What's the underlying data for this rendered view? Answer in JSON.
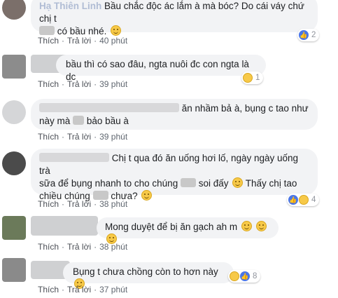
{
  "comments": [
    {
      "name": "Hạ Thiên Linh",
      "line1_rest": "Bầu chắc độc ác lắm à mà bóc? Do cái váy chứ chị t",
      "line2": "có bầu nhé.",
      "actions": {
        "like": "Thích",
        "reply": "Trả lời",
        "time": "40 phút"
      },
      "reaction_count": "2",
      "reactions": [
        "like-icon"
      ]
    },
    {
      "line1": "bầu thì có sao đâu, ngta nuôi đc con ngta là dc",
      "actions": {
        "like": "Thích",
        "reply": "Trả lời",
        "time": "39 phút"
      },
      "reaction_count": "1",
      "reactions": [
        "haha-icon"
      ]
    },
    {
      "line1": "ăn nhầm bả à, bụng c tao như",
      "line2a": "này mà",
      "line2b": "bảo bầu à",
      "actions": {
        "like": "Thích",
        "reply": "Trả lời",
        "time": "39 phút"
      }
    },
    {
      "line1": "Chị t qua đó ăn uống hơi lố, ngày ngày uống trà",
      "line2a": "sữa để bụng nhanh to cho chúng",
      "line2b": "soi đấy",
      "line2c": "Thấy chị tao",
      "line3a": "chiều chúng",
      "line3b": "chưa?",
      "actions": {
        "like": "Thích",
        "reply": "Trả lời",
        "time": "38 phút"
      },
      "reaction_count": "4",
      "reactions": [
        "like-icon",
        "haha-icon"
      ]
    },
    {
      "line1": "Mong duyệt để bị ăn gạch ah m",
      "actions": {
        "like": "Thích",
        "reply": "Trả lời",
        "time": "38 phút"
      }
    },
    {
      "line1": "Bụng t chưa chồng còn to hơn này",
      "actions": {
        "like": "Thích",
        "reply": "Trả lời",
        "time": "37 phút"
      },
      "reaction_count": "8",
      "reactions": [
        "haha-icon",
        "like-icon"
      ]
    }
  ],
  "colors": {
    "name": "#385898",
    "bubble": "#f2f3f5",
    "like": "#4a76e8",
    "haha": "#f7c948"
  }
}
